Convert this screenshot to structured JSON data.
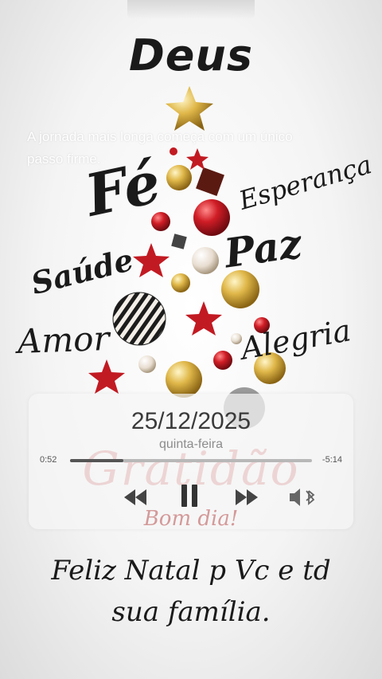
{
  "title": "Deus",
  "quote": "A jornada mais longa começa com um único passo firme.",
  "words": {
    "fe": "Fé",
    "esperanca": "Esperança",
    "saude": "Saúde",
    "paz": "Paz",
    "amor": "Amor",
    "alegria": "Alegria"
  },
  "widget": {
    "date": "25/12/2025",
    "weekday": "quinta-feira",
    "elapsed": "0:52",
    "remaining": "-5:14",
    "progress_fraction": 0.22,
    "signature": "Gratidão",
    "greeting": "Bom dia!"
  },
  "bottom_message": {
    "line1": "Feliz Natal p Vc e td",
    "line2": "sua família."
  },
  "colors": {
    "gold": "#c9a23a",
    "red": "#c21a22",
    "ink": "#1a1a1a"
  },
  "icons": [
    "star-icon",
    "rewind-icon",
    "pause-icon",
    "forward-icon",
    "airplay-icon"
  ]
}
